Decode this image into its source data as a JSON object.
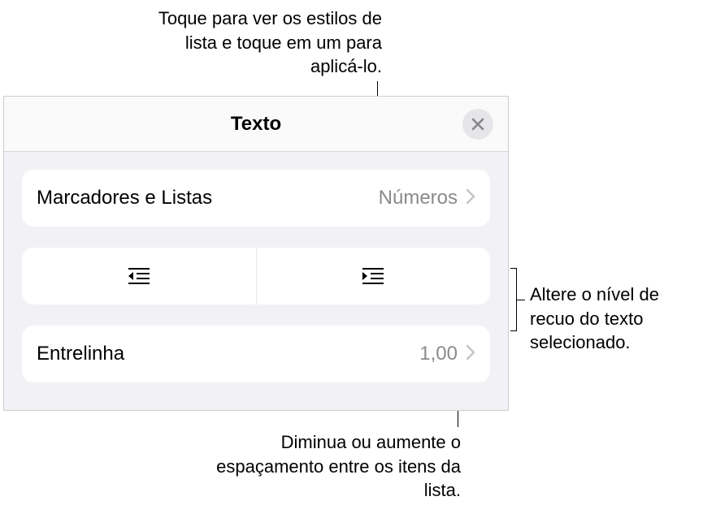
{
  "callouts": {
    "top": "Toque para ver os estilos de lista e toque em um para aplicá-lo.",
    "right": "Altere o nível de recuo do texto selecionado.",
    "bottom": "Diminua ou aumente o espaçamento entre os itens da lista."
  },
  "panel": {
    "title": "Texto",
    "bullets_and_lists": {
      "label": "Marcadores e Listas",
      "value": "Números"
    },
    "line_spacing": {
      "label": "Entrelinha",
      "value": "1,00"
    }
  }
}
